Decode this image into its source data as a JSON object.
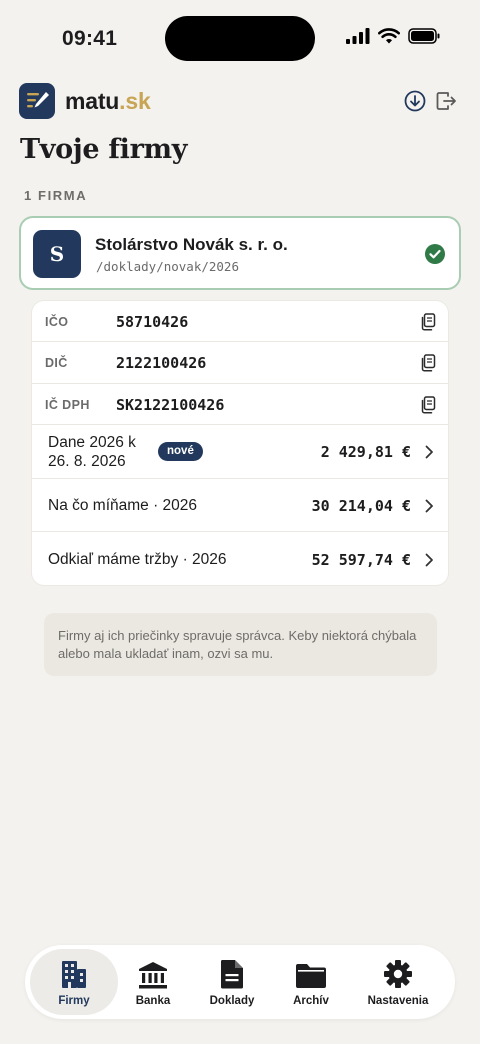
{
  "status_bar": {
    "time": "09:41"
  },
  "header": {
    "brand_name": "matu",
    "brand_tld": ".sk"
  },
  "page": {
    "title": "Tvoje firmy",
    "section_label": "1 FIRMA"
  },
  "company": {
    "avatar_letter": "S",
    "name": "Stolárstvo Novák s. r. o.",
    "path": "/doklady/novak/2026",
    "selected": true
  },
  "details": {
    "ids": [
      {
        "label": "IČO",
        "value": "58710426"
      },
      {
        "label": "DIČ",
        "value": "2122100426"
      },
      {
        "label": "IČ DPH",
        "value": "SK2122100426"
      }
    ],
    "metrics": [
      {
        "label_line1": "Dane 2026 k",
        "label_line2": "26. 8. 2026",
        "badge": "nové",
        "amount": "2 429,81 €"
      },
      {
        "label": "Na čo míňame · 2026",
        "amount": "30 214,04 €"
      },
      {
        "label": "Odkiaľ máme tržby · 2026",
        "amount": "52 597,74 €"
      }
    ]
  },
  "note": "Firmy aj ich priečinky spravuje správca. Keby niektorá chýbala alebo mala ukladať inam, ozvi sa mu.",
  "tabs": [
    {
      "label": "Firmy",
      "icon": "building-icon",
      "active": true
    },
    {
      "label": "Banka",
      "icon": "bank-icon",
      "active": false
    },
    {
      "label": "Doklady",
      "icon": "document-icon",
      "active": false
    },
    {
      "label": "Archív",
      "icon": "folder-icon",
      "active": false
    },
    {
      "label": "Nastavenia",
      "icon": "gear-icon",
      "active": false
    }
  ],
  "colors": {
    "background": "#f4f2ee",
    "navy": "#22395d",
    "gold": "#c7a554",
    "success_green": "#2f7a47",
    "selected_border": "#a9cdb3"
  }
}
